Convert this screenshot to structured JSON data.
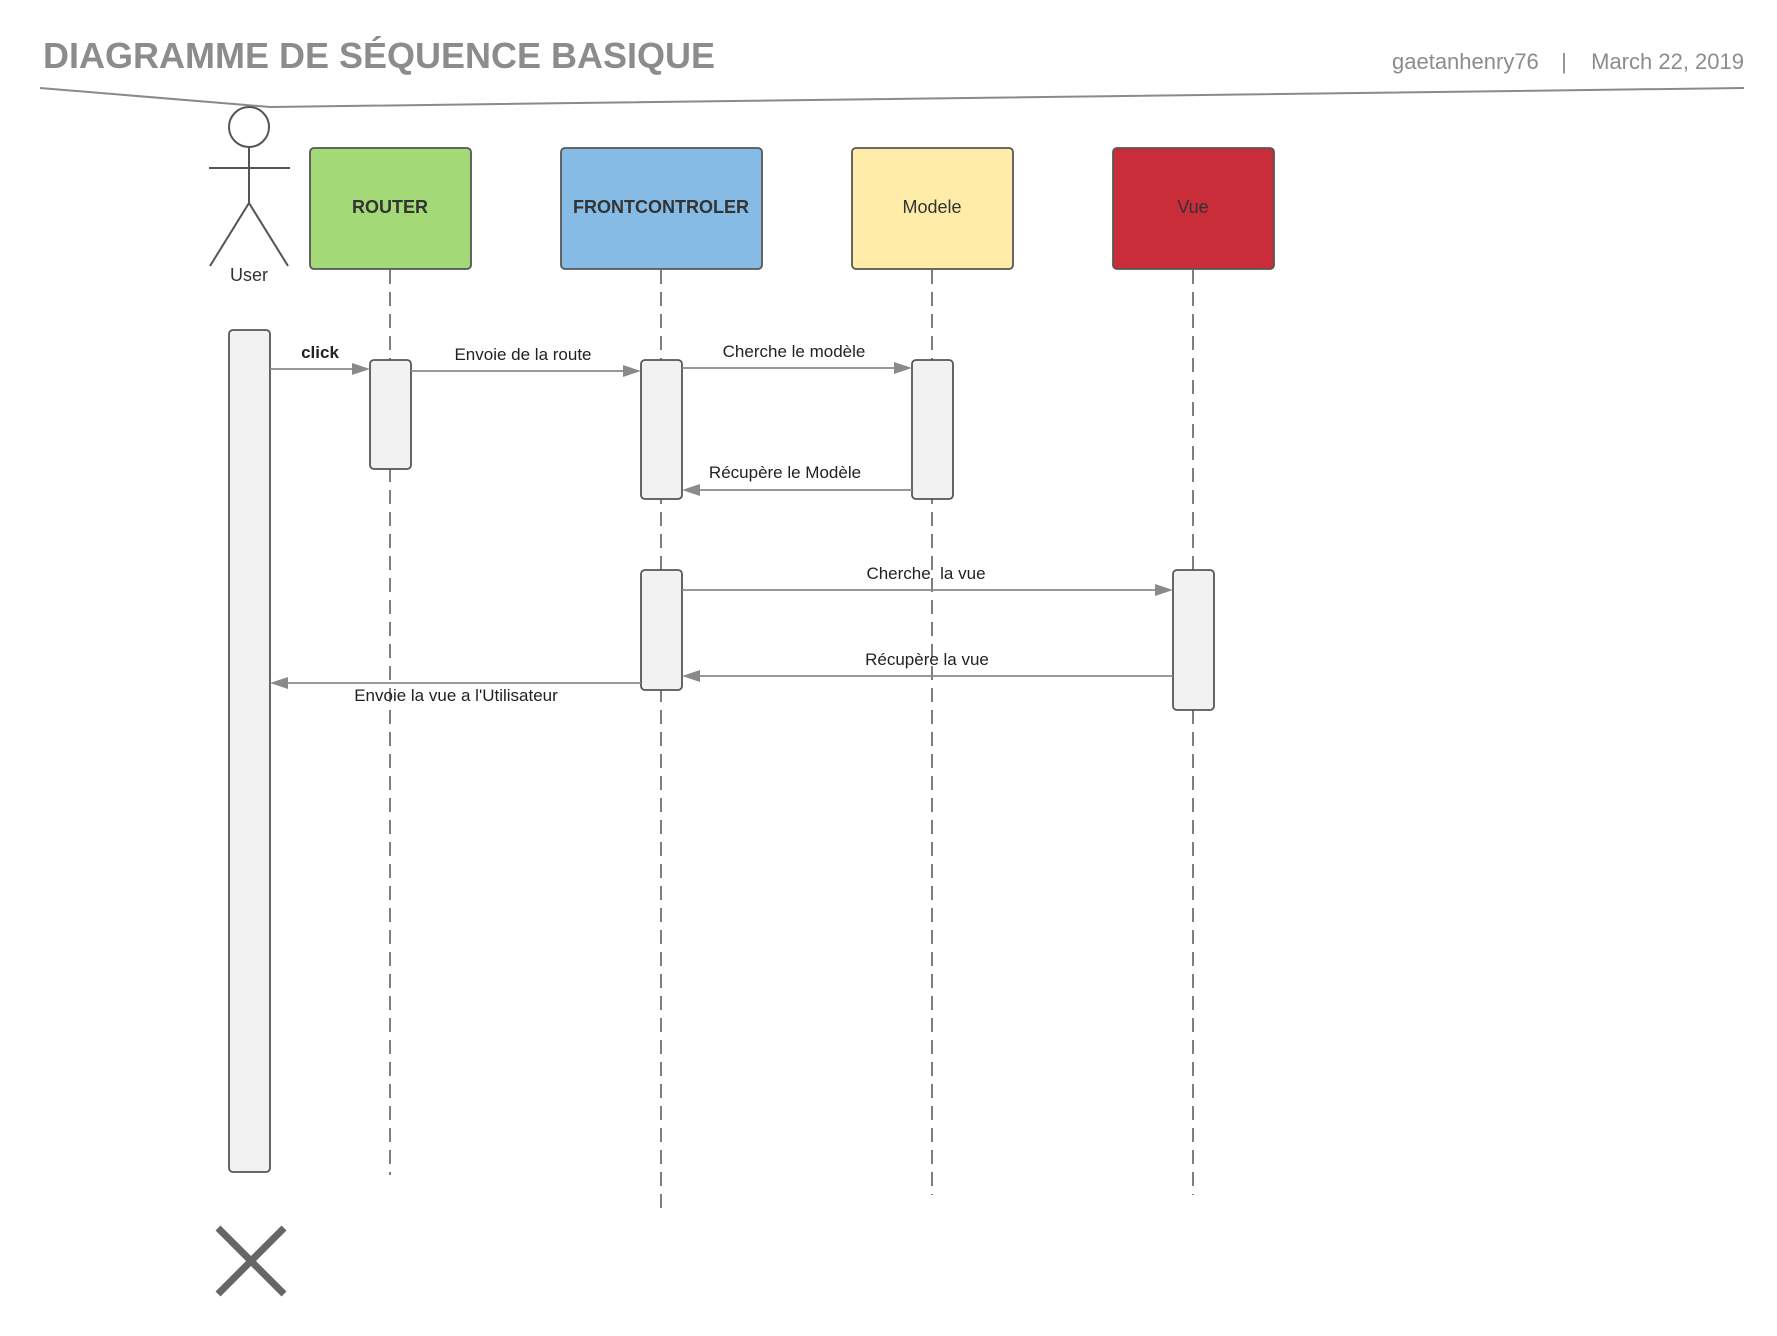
{
  "header": {
    "title": "DIAGRAMME DE SÉQUENCE BASIQUE",
    "author": "gaetanhenry76",
    "separator": "|",
    "date": "March 22, 2019"
  },
  "actor": {
    "label": "User"
  },
  "participants": [
    {
      "id": "router",
      "label": "ROUTER",
      "color": "#a3d977",
      "bold": true
    },
    {
      "id": "frontcontroler",
      "label": "FRONTCONTROLER",
      "color": "#85bbe5",
      "bold": true
    },
    {
      "id": "modele",
      "label": "Modele",
      "color": "#ffeca9",
      "bold": false
    },
    {
      "id": "vue",
      "label": "Vue",
      "color": "#c92d39",
      "bold": false
    }
  ],
  "messages": [
    {
      "from": "user",
      "to": "router",
      "label": "click",
      "bold": true
    },
    {
      "from": "router",
      "to": "frontcontroler",
      "label": "Envoie de la route",
      "bold": false
    },
    {
      "from": "frontcontroler",
      "to": "modele",
      "label": "Cherche le modèle",
      "bold": false
    },
    {
      "from": "modele",
      "to": "frontcontroler",
      "label": "Récupère le Modèle",
      "bold": false
    },
    {
      "from": "frontcontroler",
      "to": "vue",
      "label": "Cherche  la vue",
      "bold": false
    },
    {
      "from": "vue",
      "to": "frontcontroler",
      "label": "Récupère la vue",
      "bold": false
    },
    {
      "from": "frontcontroler",
      "to": "user",
      "label": "Envoie la vue a l'Utilisateur",
      "bold": false
    }
  ],
  "colors": {
    "line": "#8a8a8a",
    "border": "#555555",
    "activation_fill": "#f2f2f2",
    "header_text": "#8c8c8c"
  }
}
